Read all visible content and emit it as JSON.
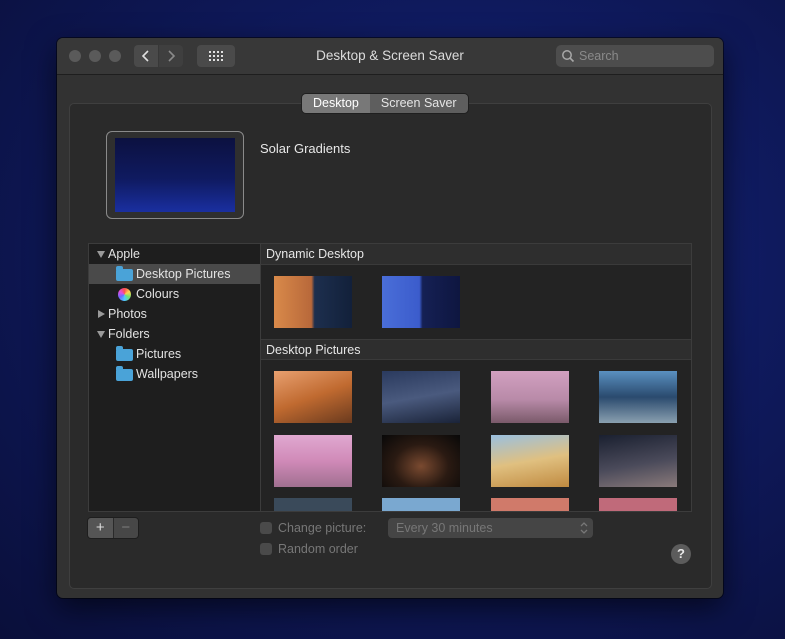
{
  "window": {
    "title": "Desktop & Screen Saver",
    "search_placeholder": "Search"
  },
  "tabs": [
    {
      "label": "Desktop",
      "selected": true
    },
    {
      "label": "Screen Saver",
      "selected": false
    }
  ],
  "current_picture": {
    "name": "Solar Gradients"
  },
  "sidebar": {
    "groups": [
      {
        "label": "Apple",
        "expanded": true
      },
      {
        "label": "Desktop Pictures",
        "selected": true
      },
      {
        "label": "Colours"
      },
      {
        "label": "Photos",
        "expanded": false
      },
      {
        "label": "Folders",
        "expanded": true
      },
      {
        "label": "Pictures"
      },
      {
        "label": "Wallpapers"
      }
    ]
  },
  "gallery": {
    "sections": [
      {
        "title": "Dynamic Desktop"
      },
      {
        "title": "Desktop Pictures"
      }
    ]
  },
  "controls": {
    "add_label": "+",
    "remove_label": "−",
    "change_picture_label": "Change picture:",
    "change_picture_checked": false,
    "interval_value": "Every 30 minutes",
    "random_order_label": "Random order",
    "random_order_checked": false,
    "help_label": "?"
  },
  "colors": {
    "accent_folder": "#4aa3d8",
    "selected_row": "#4a4a4a"
  }
}
